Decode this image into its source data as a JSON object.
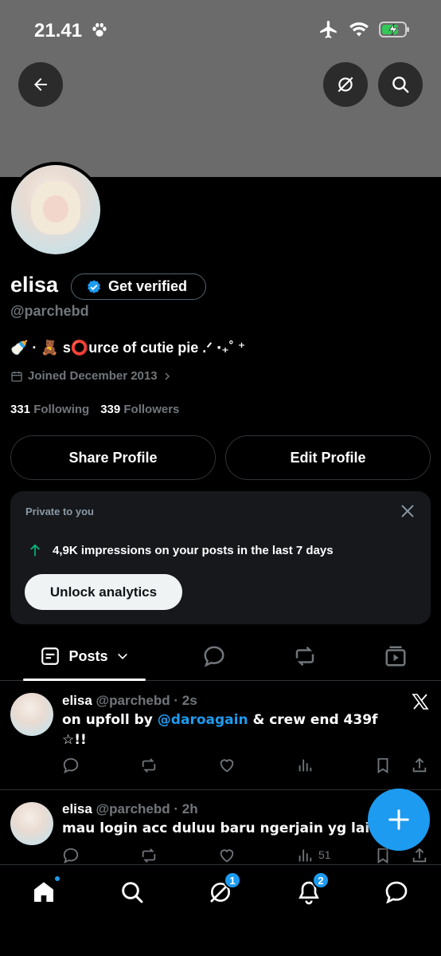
{
  "status_bar": {
    "time": "21.41"
  },
  "profile": {
    "name": "elisa",
    "get_verified_label": "Get verified",
    "handle": "@parchebd",
    "bio_prefix": "🍼 · 🧸 s",
    "bio_o": "⭕",
    "bio_suffix": "urce of cutie pie .ᐟ ‧₊˚ ⁺",
    "joined": "Joined December 2013",
    "following_count": "331",
    "following_label": "Following",
    "followers_count": "339",
    "followers_label": "Followers",
    "share_label": "Share Profile",
    "edit_label": "Edit Profile"
  },
  "analytics_card": {
    "label": "Private to you",
    "impressions_text": "4,9K impressions on your posts in the last 7 days",
    "unlock_label": "Unlock analytics"
  },
  "tabs": {
    "posts_label": "Posts"
  },
  "posts": [
    {
      "name": "elisa",
      "meta": "@parchebd · 2s",
      "text_before": "on upfoll by ",
      "mention": "@daroagain",
      "text_after": " & crew end 439f ☆!!"
    },
    {
      "name": "elisa",
      "meta": "@parchebd · 2h",
      "text": "mau login acc duluu baru ngerjain yg lain dulu",
      "views": "51"
    }
  ],
  "nav": {
    "grok_badge": "1",
    "notifications_badge": "2"
  },
  "colors": {
    "accent": "#1d9bf0",
    "banner": "#6b6b6b",
    "impressions_arrow": "#00ba7c"
  }
}
